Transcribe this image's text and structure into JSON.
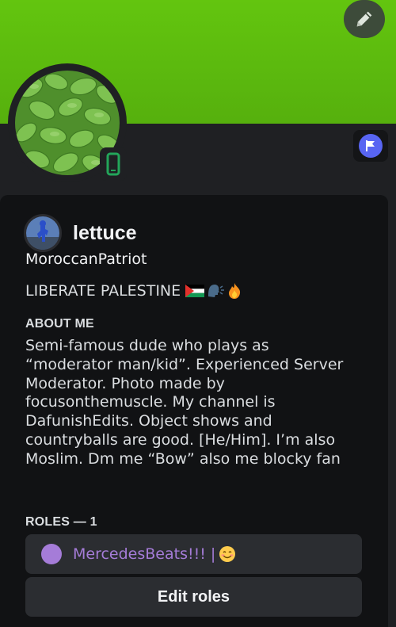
{
  "profile": {
    "display_name": "lettuce",
    "username": "MoroccanPatriot",
    "custom_status": "LIBERATE PALESTINE",
    "status_emojis": [
      "palestine-flag-icon",
      "speaking-head-icon",
      "fire-icon"
    ],
    "about_title": "ABOUT ME",
    "about_text": "Semi-famous dude who plays as “moderator man/kid”. Experienced Server Moderator. Photo made by focusonthemuscle. My channel is DafunishEdits. Object shows and countryballs are good. [He/Him]. I’m also Moslim. Dm me “Bow” also me blocky fan",
    "roles_title": "ROLES — 1",
    "roles": [
      {
        "name": "MercedesBeats!!!",
        "separator": "|",
        "emoji": "smiling-face-icon",
        "color": "#a57cd8"
      }
    ],
    "edit_roles_label": "Edit roles"
  },
  "theme": {
    "banner_color": "#5dbd0f",
    "background": "#1f2023",
    "card": "#111214",
    "accent_badge": "#5865f2",
    "status_online_mobile": "#23a55a"
  },
  "icons": {
    "edit": "pencil-icon",
    "status": "mobile-phone-icon",
    "badge": "flag-icon"
  }
}
